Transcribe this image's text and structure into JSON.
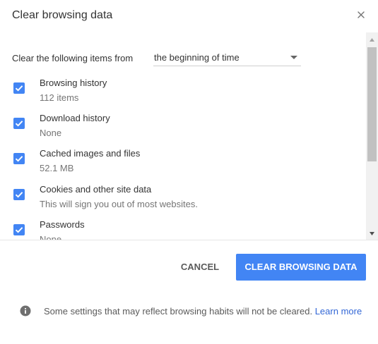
{
  "dialog": {
    "title": "Clear browsing data",
    "close_icon": "close-icon"
  },
  "time_range": {
    "label": "Clear the following items from",
    "selected": "the beginning of time"
  },
  "items": [
    {
      "label": "Browsing history",
      "detail": "112 items",
      "checked": true
    },
    {
      "label": "Download history",
      "detail": "None",
      "checked": true
    },
    {
      "label": "Cached images and files",
      "detail": "52.1 MB",
      "checked": true
    },
    {
      "label": "Cookies and other site data",
      "detail": "This will sign you out of most websites.",
      "checked": true
    },
    {
      "label": "Passwords",
      "detail": "None",
      "checked": true
    }
  ],
  "buttons": {
    "cancel": "CANCEL",
    "clear": "CLEAR BROWSING DATA"
  },
  "footer": {
    "info_icon": "info-icon",
    "text": "Some settings that may reflect browsing habits will not be cleared.",
    "link": "Learn more"
  },
  "colors": {
    "accent": "#4285f4",
    "link": "#3367d6"
  }
}
